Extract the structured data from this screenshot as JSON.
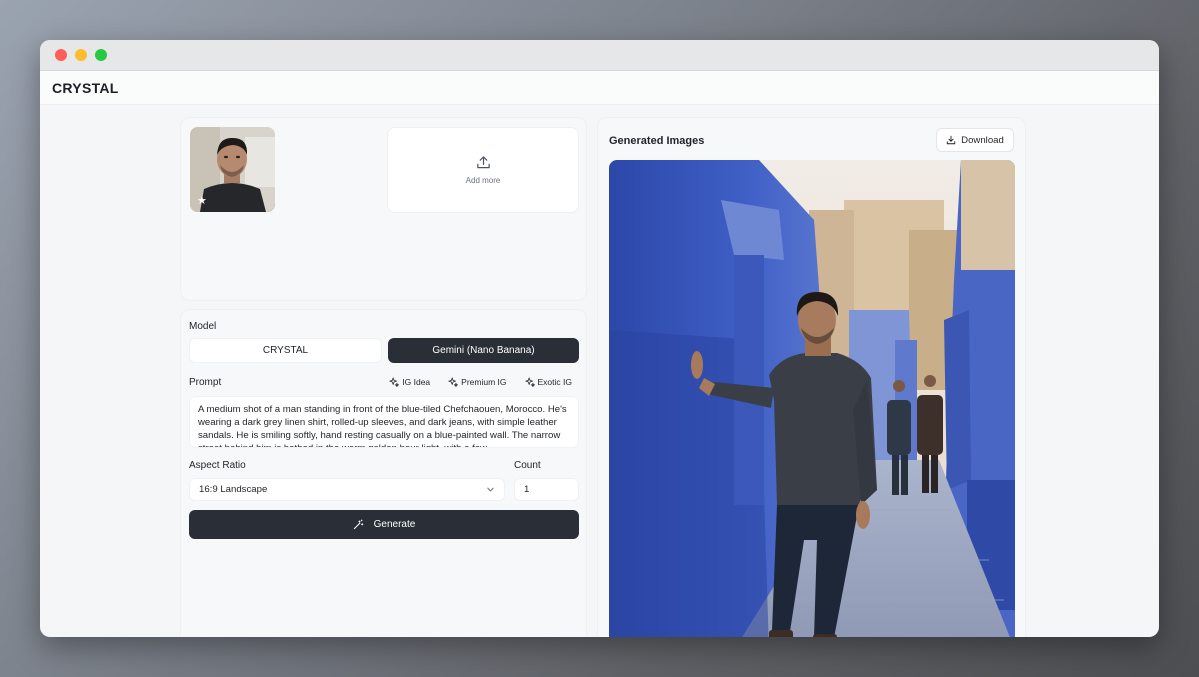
{
  "app": {
    "name": "CRYSTAL"
  },
  "references": {
    "add_more_label": "Add more",
    "primary_marker": "★"
  },
  "form": {
    "model_label": "Model",
    "models": [
      {
        "label": "CRYSTAL",
        "selected": false
      },
      {
        "label": "Gemini (Nano Banana)",
        "selected": true
      }
    ],
    "prompt_label": "Prompt",
    "prompt_presets": [
      "IG Idea",
      "Premium IG",
      "Exotic IG"
    ],
    "prompt_text": "A medium shot of a man standing in front of the blue-tiled Chefchaouen, Morocco. He's wearing a dark grey linen shirt, rolled-up sleeves, and dark jeans, with simple leather sandals. He is smiling softly, hand resting casually on a blue-painted wall. The narrow street behind him is bathed in the warm golden hour light, with a few",
    "aspect_ratio_label": "Aspect Ratio",
    "aspect_ratio_value": "16:9 Landscape",
    "count_label": "Count",
    "count_value": "1",
    "generate_label": "Generate"
  },
  "output": {
    "title": "Generated Images",
    "download_label": "Download"
  },
  "colors": {
    "accent_dark": "#2a2f37",
    "chefchaouen_blue": "#3e5fc4"
  }
}
